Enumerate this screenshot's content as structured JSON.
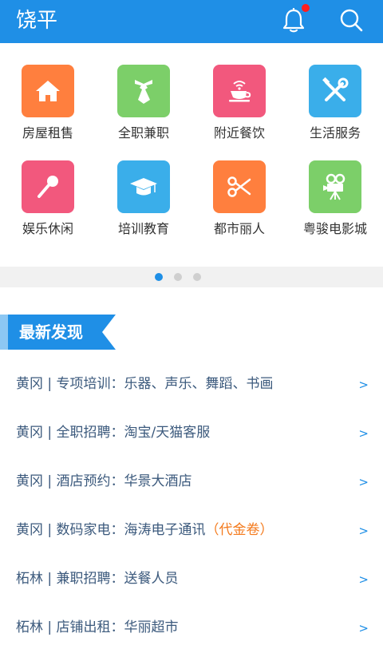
{
  "header": {
    "title": "饶平",
    "accent_color": "#1f8fe6",
    "bell_icon": "bell-icon",
    "search_icon": "search-icon"
  },
  "categories": [
    {
      "label": "房屋租售",
      "icon": "house-icon",
      "color": "#ff7f3e"
    },
    {
      "label": "全职兼职",
      "icon": "necktie-icon",
      "color": "#7ccf69"
    },
    {
      "label": "附近餐饮",
      "icon": "coffee-cup-icon",
      "color": "#f2587d"
    },
    {
      "label": "生活服务",
      "icon": "tools-icon",
      "color": "#3aaeea"
    },
    {
      "label": "娱乐休闲",
      "icon": "microphone-icon",
      "color": "#f2587d"
    },
    {
      "label": "培训教育",
      "icon": "graduation-cap-icon",
      "color": "#3aaeea"
    },
    {
      "label": "都市丽人",
      "icon": "scissors-icon",
      "color": "#ff7f3e"
    },
    {
      "label": "粤骏电影城",
      "icon": "movie-camera-icon",
      "color": "#7ccf69"
    }
  ],
  "pager": {
    "pages": 3,
    "active": 0
  },
  "section": {
    "title": "最新发现"
  },
  "list": [
    {
      "text": "黄冈 | 专项培训：乐器、声乐、舞蹈、书画",
      "highlight": "",
      "arrow": ">"
    },
    {
      "text": "黄冈 | 全职招聘：淘宝/天猫客服",
      "highlight": "",
      "arrow": ">"
    },
    {
      "text": "黄冈 | 酒店预约：华景大酒店",
      "highlight": "",
      "arrow": ">"
    },
    {
      "text": "黄冈 | 数码家电：海涛电子通讯",
      "highlight": "（代金卷）",
      "arrow": ">"
    },
    {
      "text": "柘林 | 兼职招聘：送餐人员",
      "highlight": "",
      "arrow": ">"
    },
    {
      "text": "柘林 | 店铺出租：华丽超市",
      "highlight": "",
      "arrow": ">"
    }
  ]
}
